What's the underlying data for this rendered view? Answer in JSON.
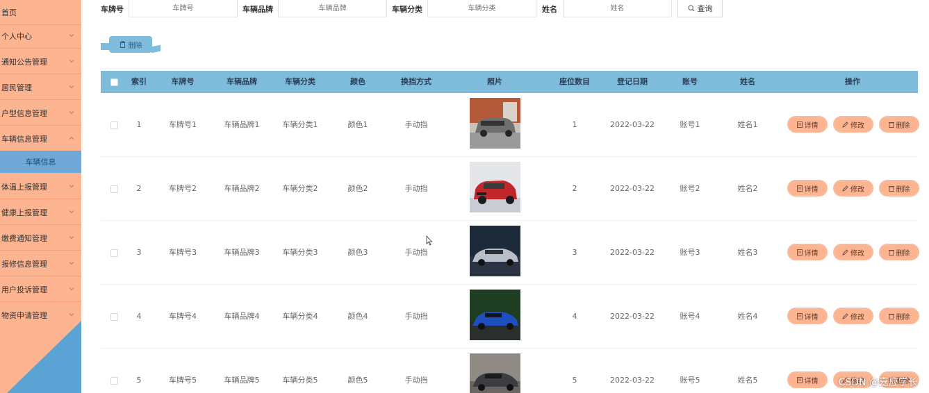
{
  "sidebar": {
    "items": [
      {
        "label": "首页"
      },
      {
        "label": "个人中心"
      },
      {
        "label": "通知公告管理"
      },
      {
        "label": "居民管理"
      },
      {
        "label": "户型信息管理"
      },
      {
        "label": "车辆信息管理"
      },
      {
        "label": "体温上报管理"
      },
      {
        "label": "健康上报管理"
      },
      {
        "label": "缴费通知管理"
      },
      {
        "label": "报修信息管理"
      },
      {
        "label": "用户投诉管理"
      },
      {
        "label": "物资申请管理"
      }
    ],
    "submenu": {
      "label": "车辆信息"
    },
    "colors": {
      "bg": "#fdb491",
      "active": "#6fa8d6",
      "corner": "#5aa3d4"
    }
  },
  "search": {
    "plate_label": "车牌号",
    "plate_placeholder": "车牌号",
    "brand_label": "车辆品牌",
    "brand_placeholder": "车辆品牌",
    "category_label": "车辆分类",
    "category_placeholder": "车辆分类",
    "name_label": "姓名",
    "name_placeholder": "姓名",
    "query_button": "查询"
  },
  "toolbar": {
    "delete_label": "删除"
  },
  "table": {
    "headers": {
      "index": "索引",
      "plate": "车牌号",
      "brand": "车辆品牌",
      "category": "车辆分类",
      "color": "颜色",
      "shift": "换挡方式",
      "photo": "照片",
      "seats": "座位数目",
      "date": "登记日期",
      "account": "账号",
      "name": "姓名",
      "ops": "操作"
    },
    "rows": [
      {
        "index": "1",
        "plate": "车牌号1",
        "brand": "车辆品牌1",
        "category": "车辆分类1",
        "color": "颜色1",
        "shift": "手动挡",
        "seats": "1",
        "date": "2022-03-22",
        "account": "账号1",
        "name": "姓名1",
        "photo_icon": "car-photo-icon"
      },
      {
        "index": "2",
        "plate": "车牌号2",
        "brand": "车辆品牌2",
        "category": "车辆分类2",
        "color": "颜色2",
        "shift": "手动挡",
        "seats": "2",
        "date": "2022-03-22",
        "account": "账号2",
        "name": "姓名2",
        "photo_icon": "car-photo-icon"
      },
      {
        "index": "3",
        "plate": "车牌号3",
        "brand": "车辆品牌3",
        "category": "车辆分类3",
        "color": "颜色3",
        "shift": "手动挡",
        "seats": "3",
        "date": "2022-03-22",
        "account": "账号3",
        "name": "姓名3",
        "photo_icon": "car-photo-icon"
      },
      {
        "index": "4",
        "plate": "车牌号4",
        "brand": "车辆品牌4",
        "category": "车辆分类4",
        "color": "颜色4",
        "shift": "手动挡",
        "seats": "4",
        "date": "2022-03-22",
        "account": "账号4",
        "name": "姓名4",
        "photo_icon": "car-photo-icon"
      },
      {
        "index": "5",
        "plate": "车牌号5",
        "brand": "车辆品牌5",
        "category": "车辆分类5",
        "color": "颜色5",
        "shift": "手动挡",
        "seats": "5",
        "date": "2022-03-22",
        "account": "账号5",
        "name": "姓名5",
        "photo_icon": "car-photo-icon"
      }
    ],
    "actions": {
      "detail": "详情",
      "edit": "修改",
      "delete": "删除"
    },
    "colors": {
      "header": "#7fbcdb",
      "action": "#fdb491"
    }
  },
  "watermark": "CSDN @嘉应学长"
}
